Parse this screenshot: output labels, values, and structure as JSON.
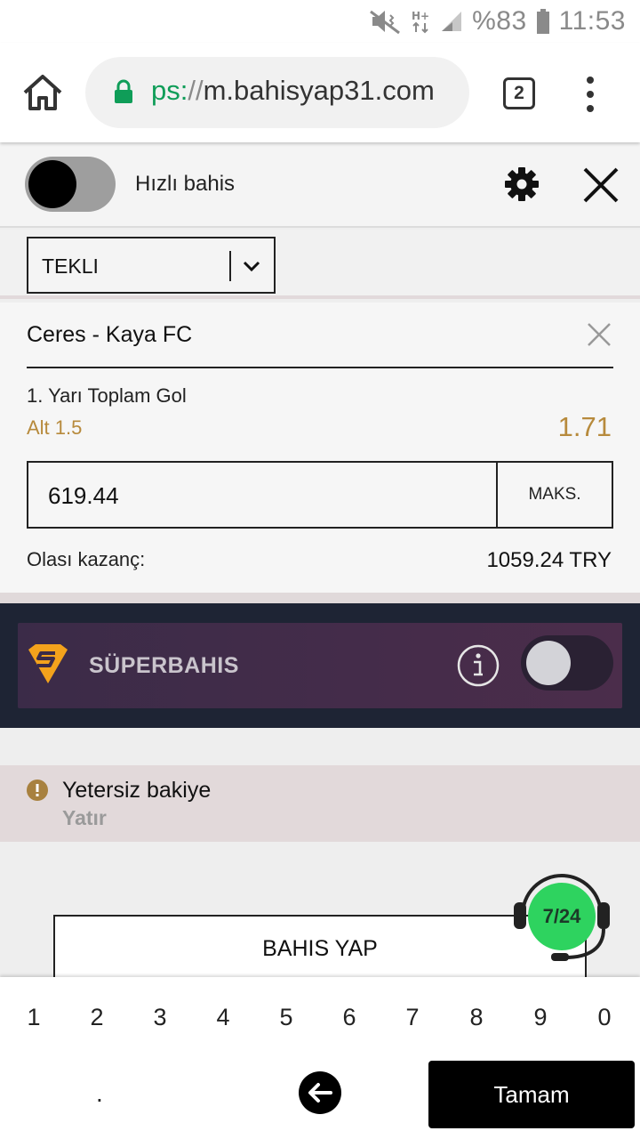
{
  "status_bar": {
    "battery": "%83",
    "time": "11:53",
    "network": "H+"
  },
  "browser": {
    "url_scheme": "ps:",
    "url_sep": "//",
    "url_host": "m.bahisyap31.com",
    "tab_count": "2"
  },
  "betslip": {
    "quick_bet_label": "Hızlı bahis",
    "bet_type": "TEKLI",
    "match": "Ceres - Kaya FC",
    "market": "1. Yarı Toplam Gol",
    "selection": "Alt 1.5",
    "odds": "1.71",
    "stake": "619.44",
    "max_label": "MAKS.",
    "potential_win_label": "Olası kazanç:",
    "potential_win_value": "1059.24 TRY",
    "superbet_label": "SÜPERBAHIS",
    "warning_title": "Yetersiz bakiye",
    "warning_link": "Yatır",
    "place_bet_label": "BAHIS YAP",
    "support_badge": "7/24"
  },
  "keyboard": {
    "digits": [
      "1",
      "2",
      "3",
      "4",
      "5",
      "6",
      "7",
      "8",
      "9",
      "0"
    ],
    "dot": ".",
    "done": "Tamam"
  },
  "colors": {
    "accent_gold": "#b78a3c",
    "url_green": "#0f9d58",
    "superbet_bg": "#1e2434",
    "support_green": "#2ed35f"
  },
  "icons": [
    "mute-icon",
    "network-h-plus-icon",
    "signal-icon",
    "battery-icon",
    "home-icon",
    "lock-icon",
    "tabs-icon",
    "overflow-menu-icon",
    "gear-icon",
    "close-icon",
    "chevron-down-icon",
    "superbet-logo-icon",
    "info-icon",
    "warning-icon",
    "headset-icon",
    "backspace-arrow-icon"
  ]
}
